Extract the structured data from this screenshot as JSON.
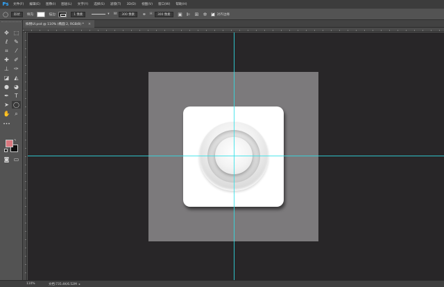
{
  "app": {
    "logo": "Ps"
  },
  "menu": [
    "文件(F)",
    "编辑(E)",
    "图像(I)",
    "图层(L)",
    "文字(Y)",
    "选择(S)",
    "滤镜(T)",
    "3D(D)",
    "视图(V)",
    "窗口(W)",
    "帮助(H)"
  ],
  "options_bar": {
    "shape_mode": "形状",
    "fill_label": "填充:",
    "stroke_label": "描边:",
    "stroke_width": "1 像素",
    "w_label": "W:",
    "w_value": "300 像素",
    "h_label": "H:",
    "h_value": "300 像素",
    "align_edges_label": "对齐边缘"
  },
  "document_tab": {
    "title": "拟物UI.psd @ 110% (椭圆 2, RGB/8) *",
    "close": "×"
  },
  "colors": {
    "foreground": "#d9787f",
    "background": "#0e0e0e",
    "guide": "#2fe0e8",
    "canvas": "#282628",
    "artboard": "#7c7a7c"
  },
  "status_bar": {
    "zoom": "110%",
    "info": "文档:735.4K/6.52M"
  }
}
